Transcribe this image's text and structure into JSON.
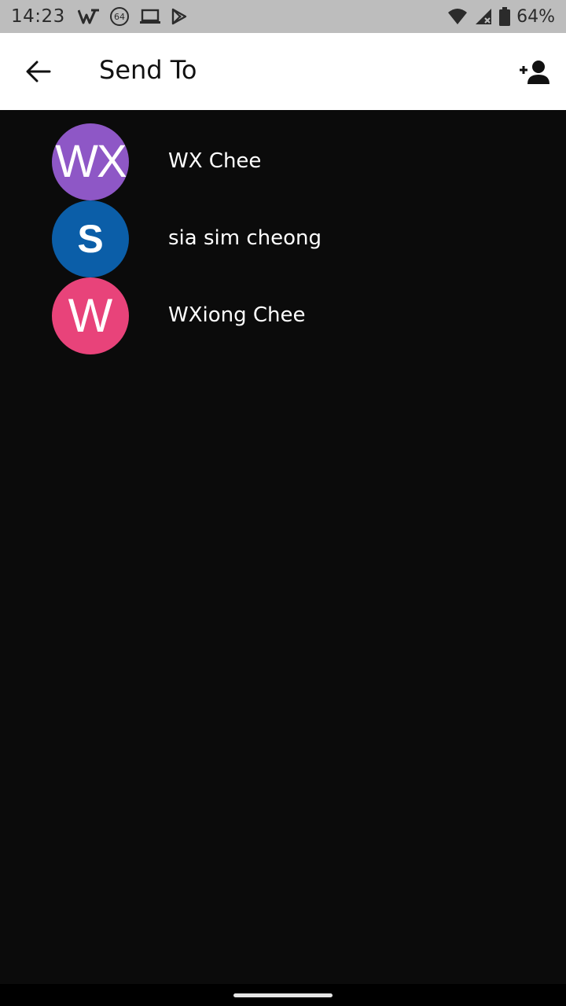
{
  "status_bar": {
    "time": "14:23",
    "left_icons": [
      "wps-icon",
      "app-64-icon",
      "laptop-icon",
      "play-store-icon"
    ],
    "app_badge_number": "64",
    "right_icons": [
      "wifi-icon",
      "signal-icon",
      "battery-icon"
    ],
    "battery_percent": "64%"
  },
  "app_bar": {
    "title": "Send To",
    "back_icon": "arrow-left-icon",
    "action_icon": "person-add-icon"
  },
  "contacts": [
    {
      "name": "WX Chee",
      "initials": "WX",
      "color": "#8e57c6"
    },
    {
      "name": "sia sim cheong",
      "initials": "S",
      "color": "#0b5ea8"
    },
    {
      "name": "WXiong Chee",
      "initials": "W",
      "color": "#e8437a"
    }
  ],
  "colors": {
    "background": "#0b0b0b",
    "app_bar": "#ffffff",
    "status_bar": "#bdbdbd"
  }
}
